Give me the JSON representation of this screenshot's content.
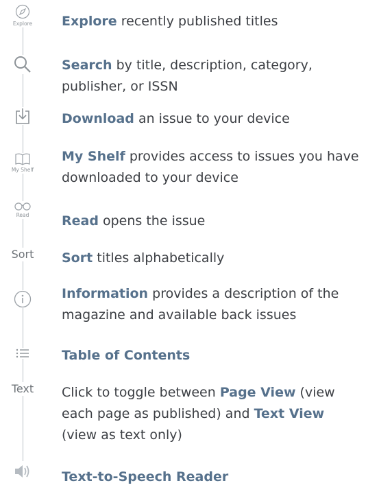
{
  "items": [
    {
      "icon": "compass-icon",
      "caption": "Explore",
      "highlight": "Explore",
      "text": " recently published titles"
    },
    {
      "icon": "search-icon",
      "caption": "",
      "highlight": "Search",
      "text": " by title, description, category, publisher, or ISSN"
    },
    {
      "icon": "download-icon",
      "caption": "",
      "highlight": "Download",
      "text": " an issue to your device"
    },
    {
      "icon": "book-icon",
      "caption": "My Shelf",
      "highlight": "My Shelf",
      "text": " provides access to issues you have downloaded to your device"
    },
    {
      "icon": "glasses-icon",
      "caption": "Read",
      "highlight": "Read",
      "text": " opens the issue"
    },
    {
      "icon": "sort-icon",
      "caption": "Sort",
      "highlight": "Sort",
      "text": " titles alphabetically"
    },
    {
      "icon": "info-icon",
      "caption": "",
      "highlight": "Information",
      "text": " provides a description of the magazine and available back issues"
    },
    {
      "icon": "list-icon",
      "caption": "",
      "highlight": "Table of Contents",
      "text": ""
    },
    {
      "icon": "text-icon",
      "caption": "Text",
      "pre": "Click to toggle between ",
      "highlight": "Page View",
      "mid": " (view each page as published) and ",
      "highlight2": "Text View",
      "text": " (view as text only)"
    },
    {
      "icon": "speaker-icon",
      "caption": "",
      "highlight": "Text-to-Speech Reader",
      "text": ""
    }
  ]
}
